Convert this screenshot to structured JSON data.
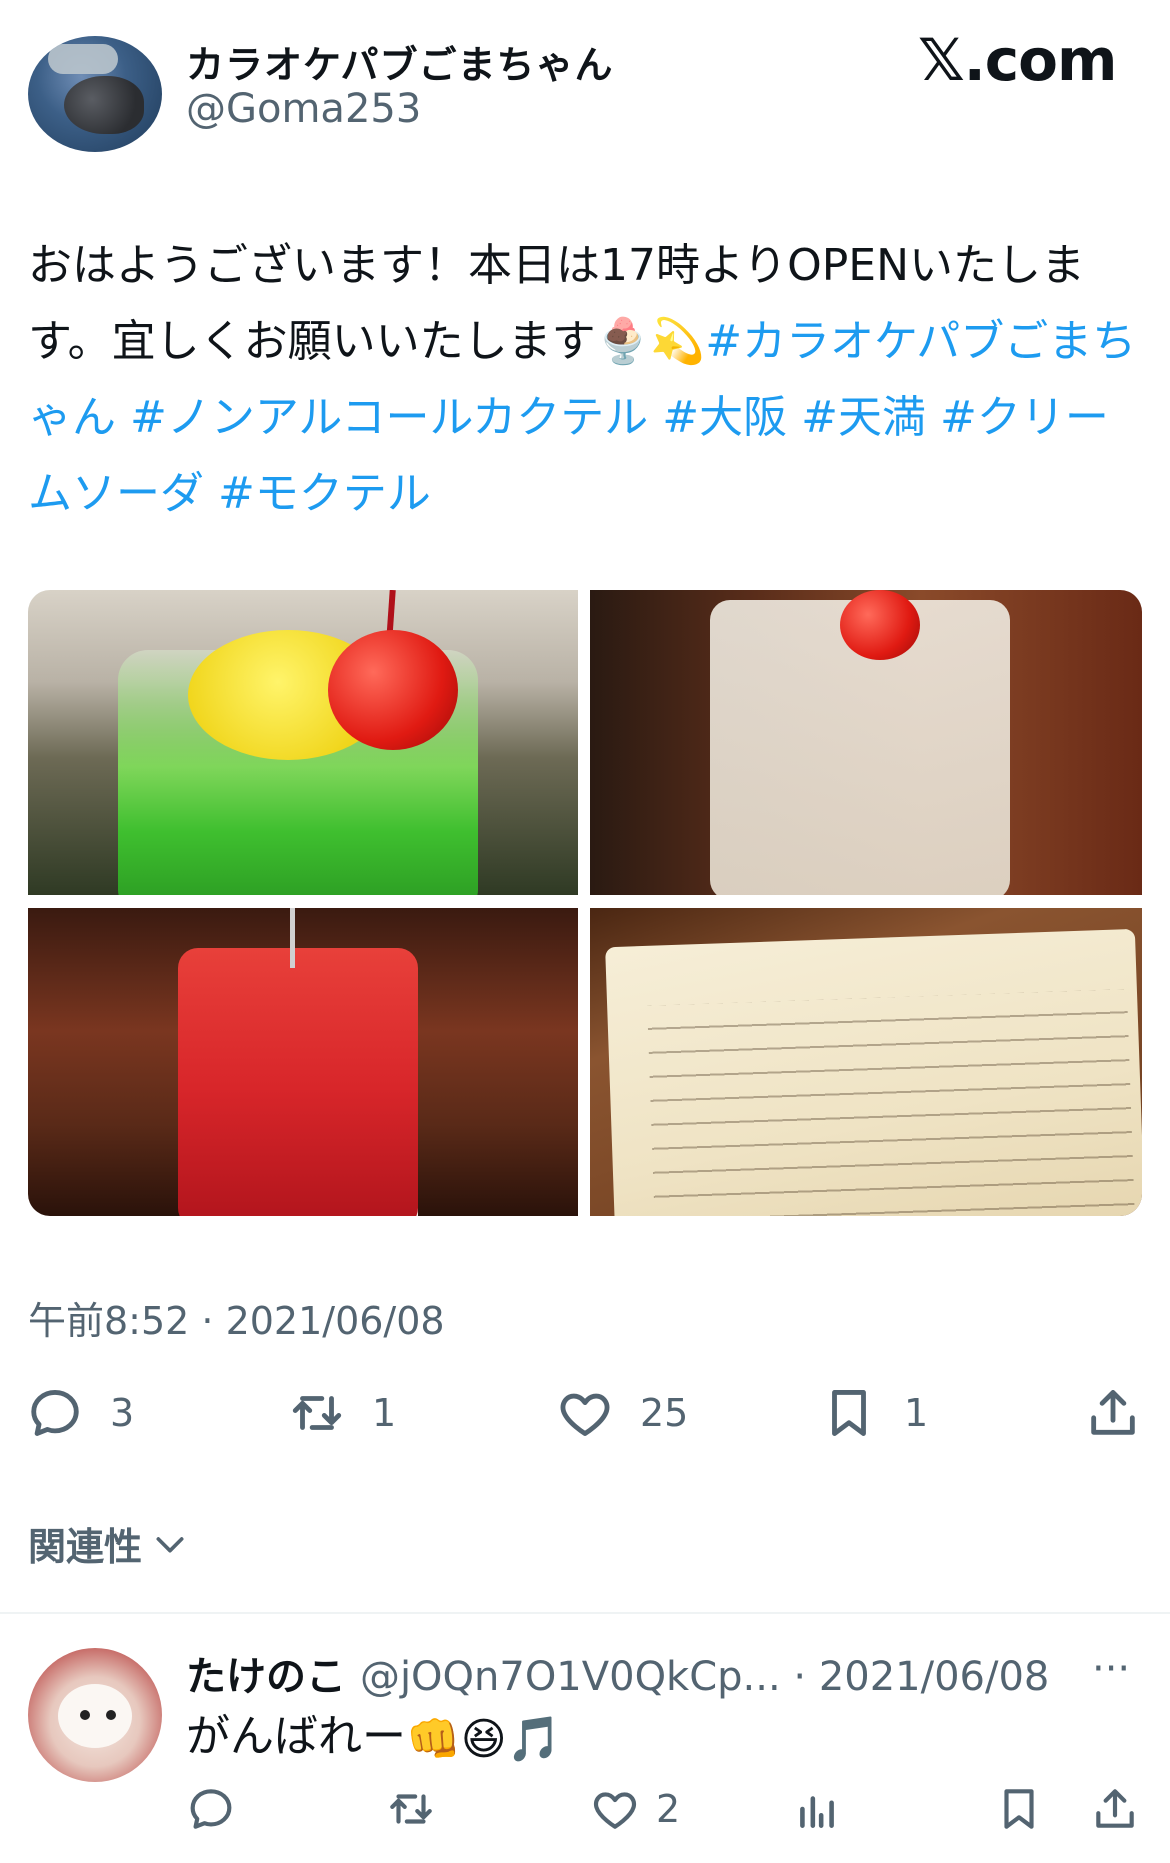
{
  "header": {
    "display_name": "カラオケパブごまちゃん",
    "handle": "@Goma253",
    "brand": "𝕏.com"
  },
  "tweet": {
    "text_plain": "おはようございます！本日は17時よりOPENいたします。宜しくお願いいたします",
    "emoji": "🍨💫",
    "hashtags": [
      "#カラオケパブごまちゃん",
      "#ノンアルコールカクテル",
      "#大阪",
      "#天満",
      "#クリームソーダ",
      "#モクテル"
    ]
  },
  "media": {
    "photo_1": "緑のクリームソーダ",
    "photo_2": "白いドリンク",
    "photo_3": "赤いドリンク",
    "photo_4": "メニュー表"
  },
  "timestamp": "午前8:52 · 2021/06/08",
  "actions": {
    "reply_count": "3",
    "retweet_count": "1",
    "like_count": "25",
    "bookmark_count": "1"
  },
  "relevance": {
    "label": "関連性"
  },
  "reply": {
    "name": "たけのこ",
    "handle_date": "@jOQn7O1V0QkCp... · 2021/06/08",
    "more": "···",
    "text": "がんばれー",
    "emoji": "👊😆🎵",
    "like_count": "2"
  }
}
